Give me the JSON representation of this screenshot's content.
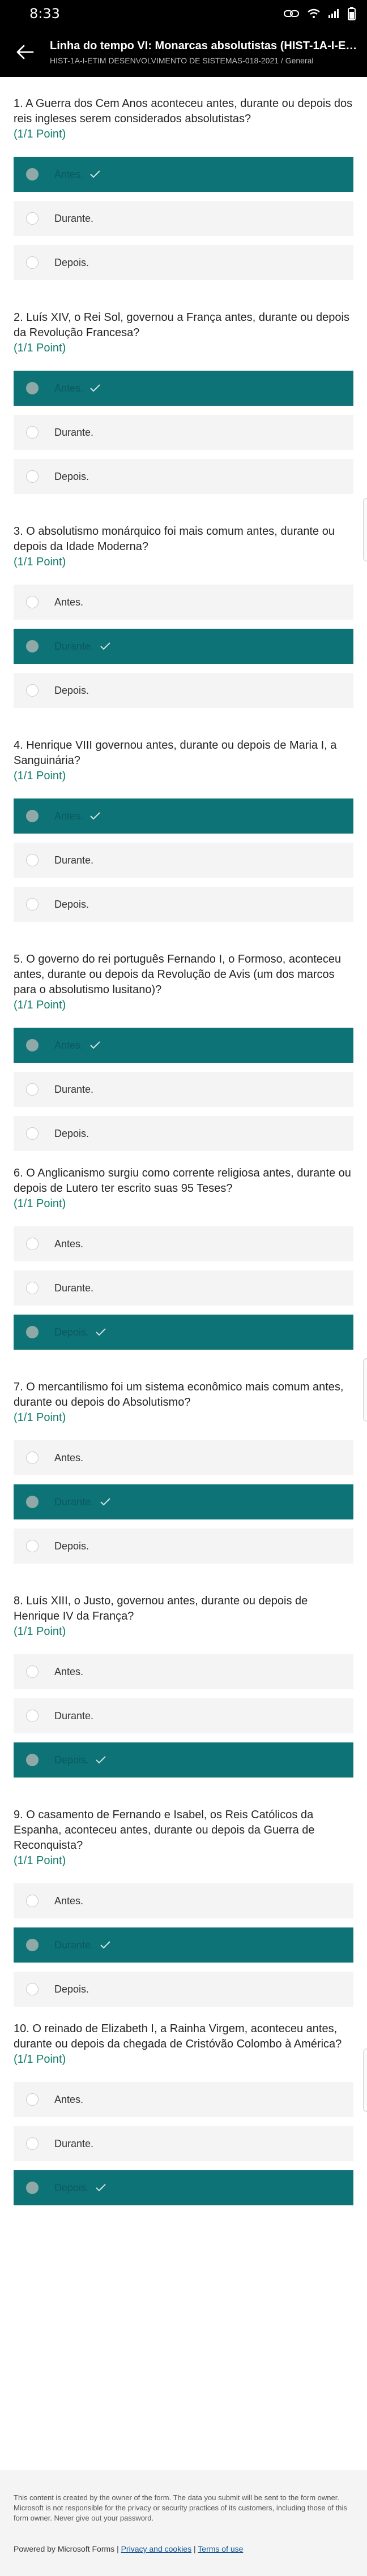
{
  "status": {
    "time": "8:33"
  },
  "header": {
    "title": "Linha do tempo VI: Monarcas absolutistas (HIST-1A-I-ETI...",
    "subtitle": "HIST-1A-I-ETIM DESENVOLVIMENTO DE SISTEMAS-018-2021 / General"
  },
  "accent_color": "#0d7377",
  "questions": [
    {
      "number": "1.",
      "text": "A Guerra dos Cem Anos aconteceu antes, durante ou depois dos reis ingleses serem considerados absolutistas?",
      "points": "(1/1 Point)",
      "options": [
        "Antes.",
        "Durante.",
        "Depois."
      ],
      "selected": 0
    },
    {
      "number": "2.",
      "text": "Luís XIV, o Rei Sol, governou a França antes, durante ou depois da Revolução Francesa?",
      "points": "(1/1 Point)",
      "options": [
        "Antes.",
        "Durante.",
        "Depois."
      ],
      "selected": 0
    },
    {
      "number": "3.",
      "text": "O absolutismo monárquico foi mais comum antes, durante ou depois da Idade Moderna?",
      "points": "(1/1 Point)",
      "options": [
        "Antes.",
        "Durante.",
        "Depois."
      ],
      "selected": 1
    },
    {
      "number": "4.",
      "text": "Henrique VIII governou antes, durante ou depois de Maria I, a Sanguinária?",
      "points": "(1/1 Point)",
      "options": [
        "Antes.",
        "Durante.",
        "Depois."
      ],
      "selected": 0
    },
    {
      "number": "5.",
      "text": "O governo do rei português Fernando I, o Formoso, aconteceu antes, durante ou depois da Revolução de Avis (um dos marcos para o absolutismo lusitano)?",
      "points": "(1/1 Point)",
      "options": [
        "Antes.",
        "Durante.",
        "Depois."
      ],
      "selected": 0
    },
    {
      "number": "6.",
      "text": "O Anglicanismo surgiu como corrente religiosa antes, durante ou depois de Lutero ter escrito suas 95 Teses?",
      "points": "(1/1 Point)",
      "options": [
        "Antes.",
        "Durante.",
        "Depois."
      ],
      "selected": 2
    },
    {
      "number": "7.",
      "text": "O mercantilismo foi um sistema econômico mais comum antes, durante ou depois do Absolutismo?",
      "points": "(1/1 Point)",
      "options": [
        "Antes.",
        "Durante.",
        "Depois."
      ],
      "selected": 1
    },
    {
      "number": "8.",
      "text": "Luís XIII, o Justo, governou antes, durante ou depois de Henrique IV da França?",
      "points": "(1/1 Point)",
      "options": [
        "Antes.",
        "Durante.",
        "Depois."
      ],
      "selected": 2
    },
    {
      "number": "9.",
      "text": "O casamento de Fernando e Isabel, os Reis Católicos da Espanha, aconteceu antes, durante ou depois da Guerra de Reconquista?",
      "points": "(1/1 Point)",
      "options": [
        "Antes.",
        "Durante.",
        "Depois."
      ],
      "selected": 1
    },
    {
      "number": "10.",
      "text": "O reinado de Elizabeth I, a Rainha Virgem, aconteceu antes, durante ou depois da chegada de Cristóvão Colombo à América?",
      "points": "(1/1 Point)",
      "options": [
        "Antes.",
        "Durante.",
        "Depois."
      ],
      "selected": 2
    }
  ],
  "footer": {
    "disclaimer": "This content is created by the owner of the form. The data you submit will be sent to the form owner. Microsoft is not responsible for the privacy or security practices of its customers, including those of this form owner. Never give out your password.",
    "powered_by": "Powered by Microsoft Forms",
    "separator": "|",
    "privacy_link": "Privacy and cookies",
    "terms_link": "Terms of use"
  }
}
